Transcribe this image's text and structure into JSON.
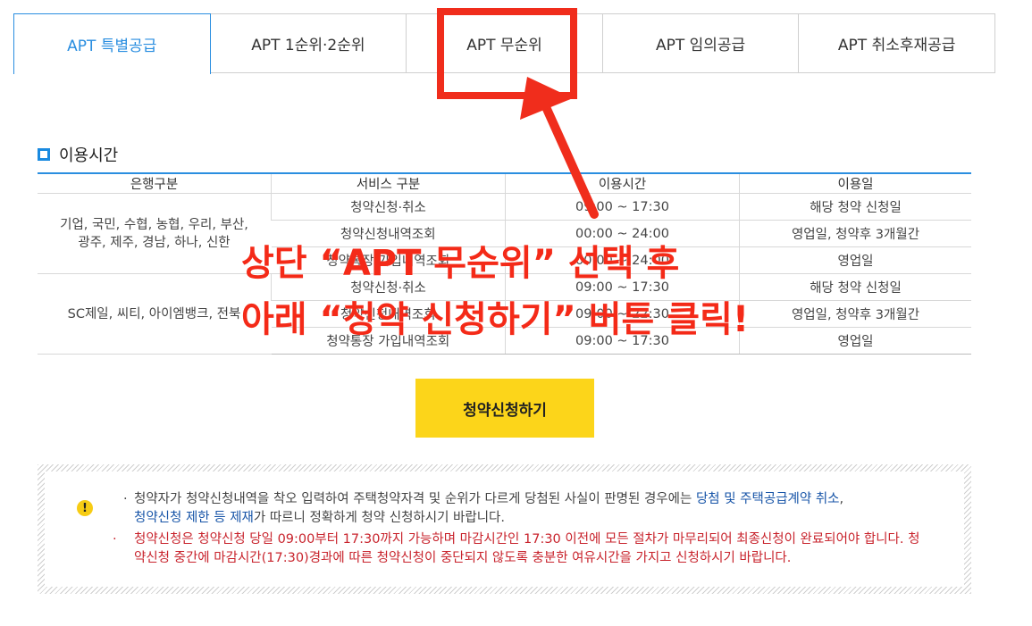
{
  "tabs": [
    {
      "label": "APT 특별공급",
      "active": true
    },
    {
      "label": "APT 1순위·2순위",
      "active": false
    },
    {
      "label": "APT 무순위",
      "active": false
    },
    {
      "label": "APT 임의공급",
      "active": false
    },
    {
      "label": "APT 취소후재공급",
      "active": false
    }
  ],
  "section": {
    "title": "이용시간",
    "icon": "square-bullet-icon"
  },
  "table": {
    "headers": [
      "은행구분",
      "서비스 구분",
      "이용시간",
      "이용일"
    ],
    "groups": [
      {
        "bank": [
          "기업, 국민, 수협, 농협, 우리, 부산,",
          "광주, 제주, 경남, 하나, 신한"
        ],
        "rows": [
          {
            "service": "청약신청·취소",
            "time": "09:00 ~ 17:30",
            "day": "해당 청약 신청일"
          },
          {
            "service": "청약신청내역조회",
            "time": "00:00 ~ 24:00",
            "day": "영업일, 청약후 3개월간"
          },
          {
            "service": "청약통장 가입내역조회",
            "time": "00:00 ~ 24:00",
            "day": "영업일"
          }
        ]
      },
      {
        "bank": [
          "SC제일, 씨티, 아이엠뱅크, 전북"
        ],
        "rows": [
          {
            "service": "청약신청·취소",
            "time": "09:00 ~ 17:30",
            "day": "해당 청약 신청일"
          },
          {
            "service": "청약신청내역조회",
            "time": "09:00 ~ 22:30",
            "day": "영업일, 청약후 3개월간"
          },
          {
            "service": "청약통장 가입내역조회",
            "time": "09:00 ~ 17:30",
            "day": "영업일"
          }
        ]
      }
    ]
  },
  "apply_button": {
    "label": "청약신청하기",
    "color": "#fcd51a"
  },
  "notice": {
    "icon": "warning-icon",
    "bullet": "·",
    "n1_a": "청약자가 청약신청내역을 착오 입력하여 주택청약자격 및 순위가 다르게 당첨된 사실이 판명된 경우에는 ",
    "n1_link1": "당첨 및 주택공급계약 취소",
    "n1_b": ",",
    "n1_link2": "청약신청 제한 등 제재",
    "n1_c": "가 따르니 정확하게 청약 신청하시기 바랍니다.",
    "n2": "청약신청은 청약신청 당일 09:00부터 17:30까지 가능하며 마감시간인 17:30 이전에 모든 절차가 마무리되어 최종신청이 완료되어야 합니다. 청약신청 중간에 마감시간(17:30)경과에 따른 청약신청이 중단되지 않도록 충분한 여유시간을 가지고 신청하시기 바랍니다."
  },
  "annotation": {
    "line1": "상단 “APT 무순위” 선택 후",
    "line2": "아래 “청약 신청하기” 버튼 클릭!",
    "color": "#f02d1c"
  },
  "colors": {
    "accent": "#2a8ee0",
    "link": "#1855a8",
    "warning_text": "#c8232c"
  }
}
